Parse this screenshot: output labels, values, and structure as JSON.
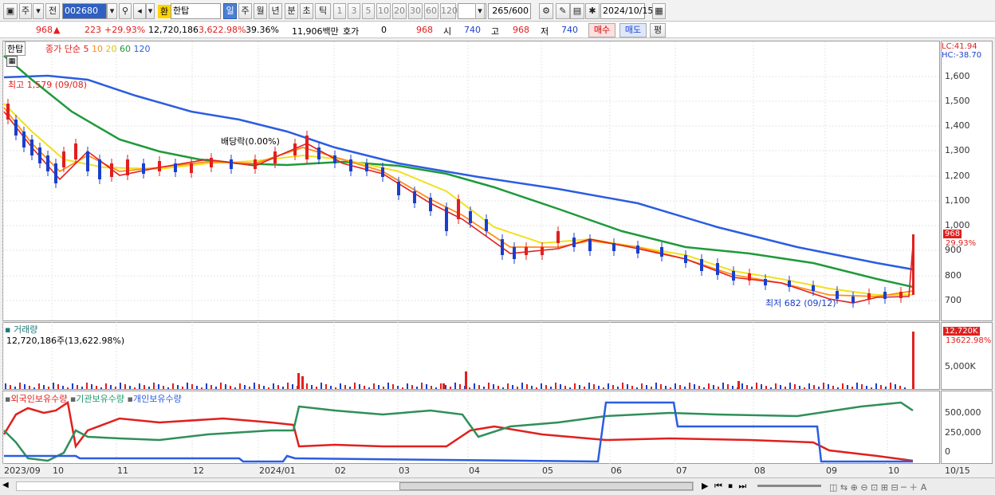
{
  "toolbar": {
    "period_tabs": [
      "주",
      "전"
    ],
    "code": "002680",
    "exchange_badge": "환",
    "name": "한탑",
    "intervals": [
      "일",
      "주",
      "월",
      "년",
      "분",
      "초",
      "틱"
    ],
    "numbers": [
      "1",
      "3",
      "5",
      "10",
      "20",
      "30",
      "60",
      "120"
    ],
    "count": "265",
    "count_max": "/600",
    "date": "2024/10/15"
  },
  "quote": {
    "price": "968",
    "change": "223",
    "change_pct": "+29.93%",
    "volume": "12,720,186",
    "volume_pct": "3,622.98%",
    "turnover": "39.36%",
    "amount": "11,906백만",
    "hoga_label": "호가",
    "hoga_value": "0",
    "hoga_price": "968",
    "open_label": "시",
    "open": "740",
    "high_label": "고",
    "high": "968",
    "low_label": "저",
    "low": "740",
    "buy": "매수",
    "sell": "매도",
    "avg": "평"
  },
  "price_pane": {
    "stock_label": "한탑",
    "ma_label": "종가 단순",
    "ma_periods": [
      "5",
      "10",
      "20",
      "60",
      "120"
    ],
    "lc": "LC:41.94",
    "hc": "HC:-38.70",
    "high_marker": "최고 1,579 (09/08)",
    "low_marker": "최저 682 (09/12)",
    "dividend": "배당락(0.00%)",
    "price_tag": "968",
    "pct_tag": "29.93%",
    "y_ticks": [
      "1,600",
      "1,500",
      "1,400",
      "1,300",
      "1,200",
      "1,100",
      "1,000",
      "900",
      "800",
      "700"
    ]
  },
  "volume_pane": {
    "title": "거래량",
    "summary": "12,720,186주(13,622.98%)",
    "tag1": "12,720K",
    "tag2": "13622.98%",
    "y_tick": "5,000K"
  },
  "holdings_pane": {
    "legend": [
      "외국인보유수량",
      "기관보유수량",
      "개인보유수량"
    ],
    "y_ticks": [
      "500,000",
      "250,000",
      "0"
    ]
  },
  "x_axis": [
    "2023/09",
    "10",
    "11",
    "12",
    "2024/01",
    "02",
    "03",
    "04",
    "05",
    "06",
    "07",
    "08",
    "09",
    "10",
    "10/15"
  ],
  "colors": {
    "ma5": "#e0201e",
    "ma10": "#ff8c1a",
    "ma20": "#f0e020",
    "ma60": "#1f9a3a",
    "ma120": "#2b5de0",
    "up": "#e0201e",
    "down": "#1a3fcc"
  }
}
